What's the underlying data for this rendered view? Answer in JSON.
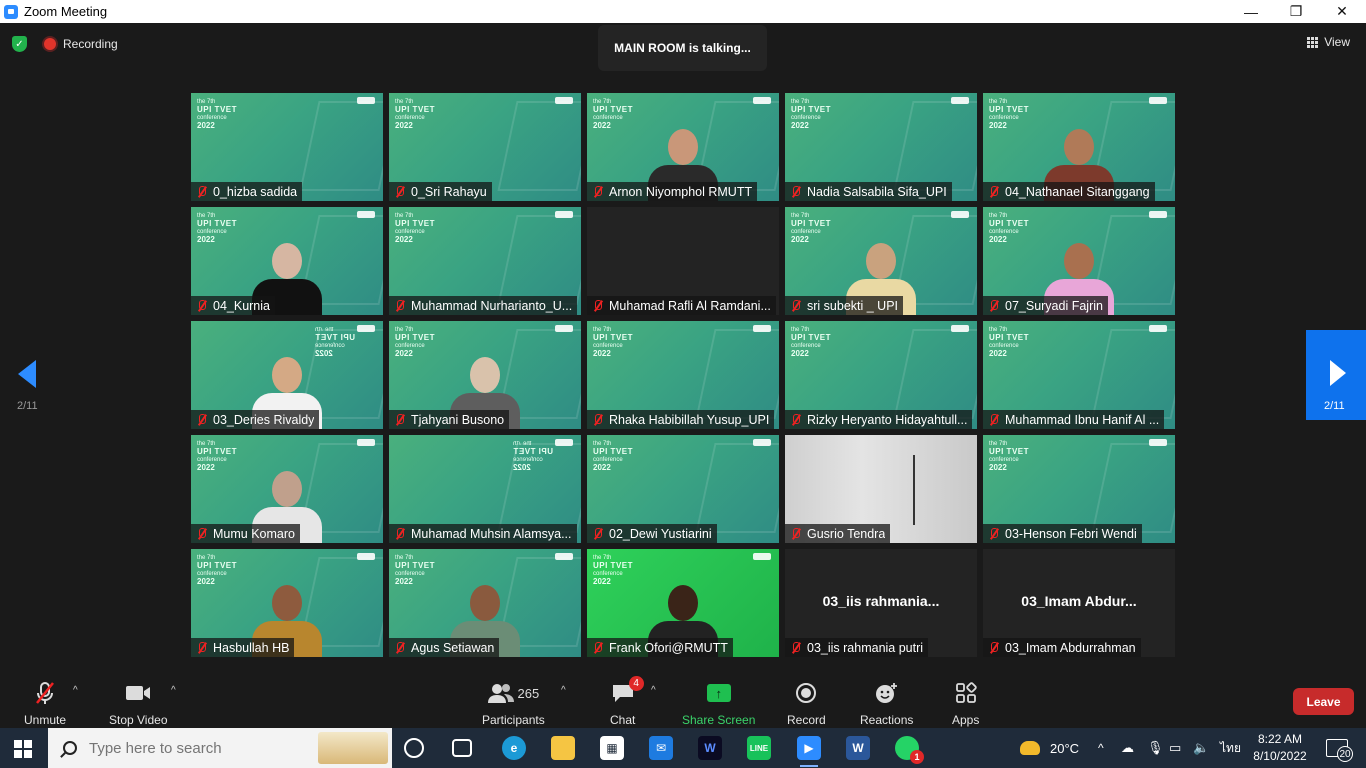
{
  "window": {
    "title": "Zoom Meeting",
    "minimize_icon": "—",
    "maximize_icon": "❐",
    "close_icon": "✕"
  },
  "header": {
    "recording_label": "Recording",
    "talking_text": "MAIN ROOM is talking...",
    "view_label": "View"
  },
  "pager": {
    "prev_page": "2/11",
    "next_page": "2/11"
  },
  "brand": {
    "line1": "the 7th",
    "line2": "UPI TVET",
    "line3": "conference",
    "line4": "2022"
  },
  "participants": [
    {
      "name": "0_hizba sadida",
      "video": "bg"
    },
    {
      "name": "0_Sri Rahayu",
      "video": "bg"
    },
    {
      "name": "Arnon Niyomphol RMUTT",
      "video": "person",
      "skin": "#c99779",
      "shirt": "#2a2a2a"
    },
    {
      "name": "Nadia Salsabila Sifa_UPI",
      "video": "bg"
    },
    {
      "name": "04_Nathanael Sitanggang",
      "video": "person",
      "skin": "#b07a58",
      "shirt": "#7d3a2c"
    },
    {
      "name": "04_Kurnia",
      "video": "person",
      "skin": "#d6b6a2",
      "shirt": "#111111"
    },
    {
      "name": "Muhammad Nurharianto_U...",
      "video": "bg"
    },
    {
      "name": "Muhamad Rafli Al Ramdani...",
      "video": "dark"
    },
    {
      "name": "sri subekti _ UPI",
      "video": "person",
      "skin": "#c9a27e",
      "shirt": "#e9d9a3"
    },
    {
      "name": "07_Suryadi Fajrin",
      "video": "person",
      "skin": "#a9704f",
      "shirt": "#e8a6d8"
    },
    {
      "name": "03_Deries Rivaldy",
      "video": "person",
      "skin": "#d4a985",
      "shirt": "#f2f2f2",
      "mirror": true
    },
    {
      "name": "Tjahyani Busono",
      "video": "person",
      "skin": "#d9c2ab",
      "shirt": "#5e5e5e"
    },
    {
      "name": "Rhaka Habibillah Yusup_UPI",
      "video": "bg"
    },
    {
      "name": "Rizky Heryanto Hidayahtull...",
      "video": "bg"
    },
    {
      "name": "Muhammad Ibnu Hanif Al ...",
      "video": "bg"
    },
    {
      "name": "Mumu Komaro",
      "video": "person",
      "skin": "#c0a08c",
      "shirt": "#e6e6e6"
    },
    {
      "name": "Muhamad Muhsin Alamsya...",
      "video": "bg",
      "mirror": true
    },
    {
      "name": "02_Dewi Yustiarini",
      "video": "bg"
    },
    {
      "name": "Gusrio Tendra",
      "video": "wall"
    },
    {
      "name": "03-Henson Febri Wendi",
      "video": "bg"
    },
    {
      "name": "Hasbullah HB",
      "video": "person",
      "skin": "#8e5b3e",
      "shirt": "#b8862e"
    },
    {
      "name": "Agus Setiawan",
      "video": "person",
      "skin": "#8a5a3e",
      "shirt": "#6b8d76"
    },
    {
      "name": "Frank Ofori@RMUTT",
      "video": "person",
      "skin": "#3a2418",
      "shirt": "#222222",
      "green": true
    },
    {
      "name": "03_iis rahmania putri",
      "video": "dark",
      "big": "03_iis  rahmania..."
    },
    {
      "name": "03_Imam Abdurrahman",
      "video": "dark",
      "big": "03_Imam  Abdur..."
    }
  ],
  "toolbar": {
    "unmute": "Unmute",
    "stop_video": "Stop Video",
    "participants": "Participants",
    "participants_count": "265",
    "chat": "Chat",
    "chat_badge": "4",
    "share_screen": "Share Screen",
    "record": "Record",
    "reactions": "Reactions",
    "apps": "Apps",
    "leave": "Leave"
  },
  "taskbar": {
    "search_placeholder": "Type here to search",
    "weather": "20°C",
    "language": "ไทย",
    "time": "8:22 AM",
    "date": "8/10/2022",
    "notifications": "20",
    "whatsapp_badge": "1"
  },
  "colors": {
    "zoom_blue": "#0e72ed",
    "leave_red": "#c72b2b",
    "share_green": "#1fbf50",
    "muted_red": "#e22222"
  }
}
